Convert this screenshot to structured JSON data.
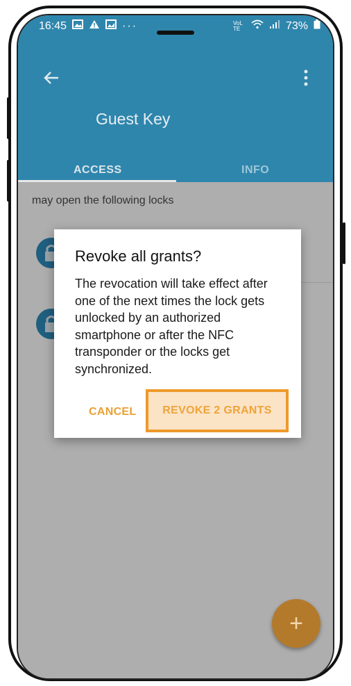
{
  "status_bar": {
    "time": "16:45",
    "battery_percent": "73%",
    "network_label": "VoLTE"
  },
  "app_bar": {
    "title": "Guest Key"
  },
  "tabs": [
    {
      "label": "ACCESS",
      "active": true
    },
    {
      "label": "INFO",
      "active": false
    }
  ],
  "content": {
    "subheading": "may open the following locks"
  },
  "dialog": {
    "title": "Revoke all grants?",
    "body": "The revocation will take effect after one of the next times the lock gets unlocked by an authorized smartphone or after the NFC transponder or the locks get synchronized.",
    "cancel_label": "CANCEL",
    "confirm_label": "REVOKE 2 GRANTS"
  },
  "fab": {
    "icon": "plus-icon",
    "label": "+"
  },
  "colors": {
    "primary": "#2f86ad",
    "accent": "#ee9a2a",
    "overlay": "#aeaeae"
  }
}
